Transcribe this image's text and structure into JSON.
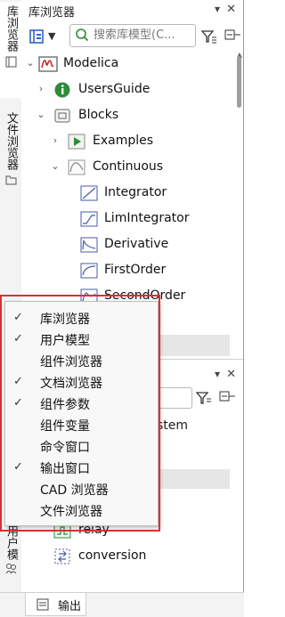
{
  "side_tabs": {
    "library_browser": "库浏览器",
    "file_browser": "文件浏览器",
    "user_models_partial": "用户模"
  },
  "library_panel": {
    "title": "库浏览器",
    "search_placeholder": "搜索库模型(C..."
  },
  "tree": {
    "modelica": "Modelica",
    "usersguide": "UsersGuide",
    "blocks": "Blocks",
    "examples": "Examples",
    "continuous": "Continuous",
    "integrator": "Integrator",
    "limintegrator": "LimIntegrator",
    "derivative": "Derivative",
    "firstorder": "FirstOrder",
    "secondorder": "SecondOrder"
  },
  "second_panel": {
    "partial_text": "stem",
    "relay": "relay",
    "conversion": "conversion"
  },
  "bottom_tab": {
    "output": "输出"
  },
  "context_menu": {
    "items": [
      {
        "label": "库浏览器",
        "checked": true
      },
      {
        "label": "用户模型",
        "checked": true
      },
      {
        "label": "组件浏览器",
        "checked": false
      },
      {
        "label": "文档浏览器",
        "checked": true
      },
      {
        "label": "组件参数",
        "checked": true
      },
      {
        "label": "组件变量",
        "checked": false
      },
      {
        "label": "命令窗口",
        "checked": false
      },
      {
        "label": "输出窗口",
        "checked": true
      },
      {
        "label": "CAD 浏览器",
        "checked": false
      },
      {
        "label": "文件浏览器",
        "checked": false
      }
    ],
    "check_glyph": "✓"
  },
  "colors": {
    "highlight_box": "#d93030",
    "accent_blue": "#2b66c4",
    "play_green": "#2e8b3a"
  }
}
